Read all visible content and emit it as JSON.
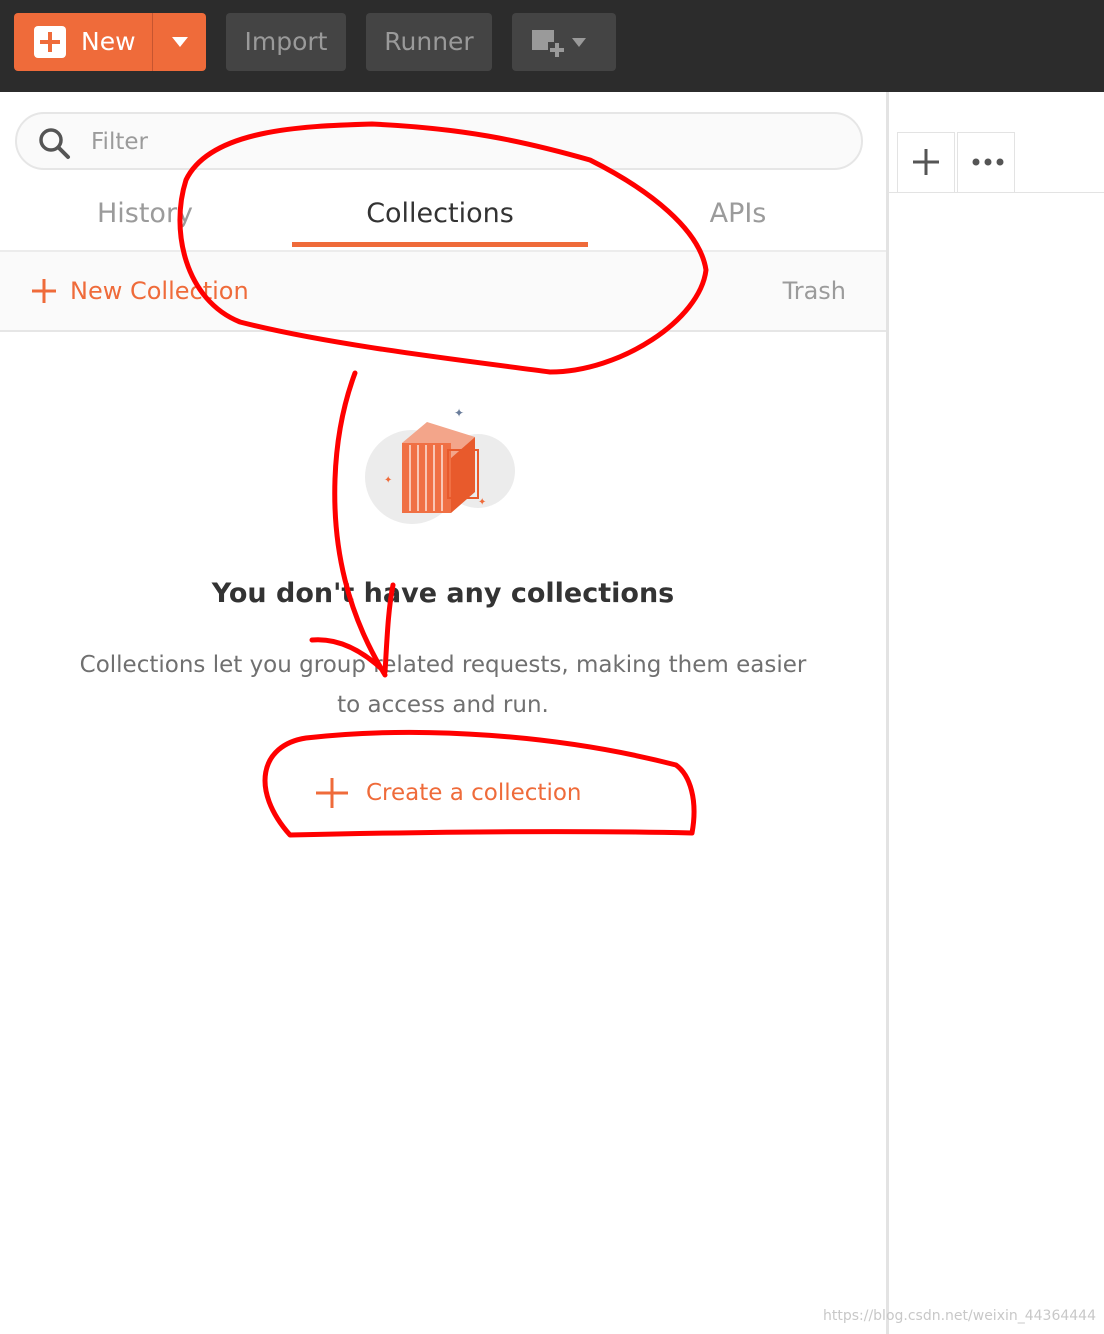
{
  "toolbar": {
    "new_label": "New",
    "import_label": "Import",
    "runner_label": "Runner",
    "icons": [
      "plus-icon",
      "caret-down-icon",
      "new-window-icon"
    ]
  },
  "sidebar": {
    "filter_placeholder": "Filter",
    "tabs": [
      {
        "label": "History",
        "active": false
      },
      {
        "label": "Collections",
        "active": true
      },
      {
        "label": "APIs",
        "active": false
      }
    ],
    "new_collection_label": "New Collection",
    "trash_label": "Trash"
  },
  "empty_state": {
    "title": "You don't have any collections",
    "description": "Collections let you group related requests, making them easier to access and run.",
    "action_label": "Create a collection"
  },
  "watermark": "https://blog.csdn.net/weixin_44364444",
  "colors": {
    "accent": "#ef6b3a",
    "toolbar_bg": "#2c2c2c",
    "annotation_red": "#ff0000"
  }
}
